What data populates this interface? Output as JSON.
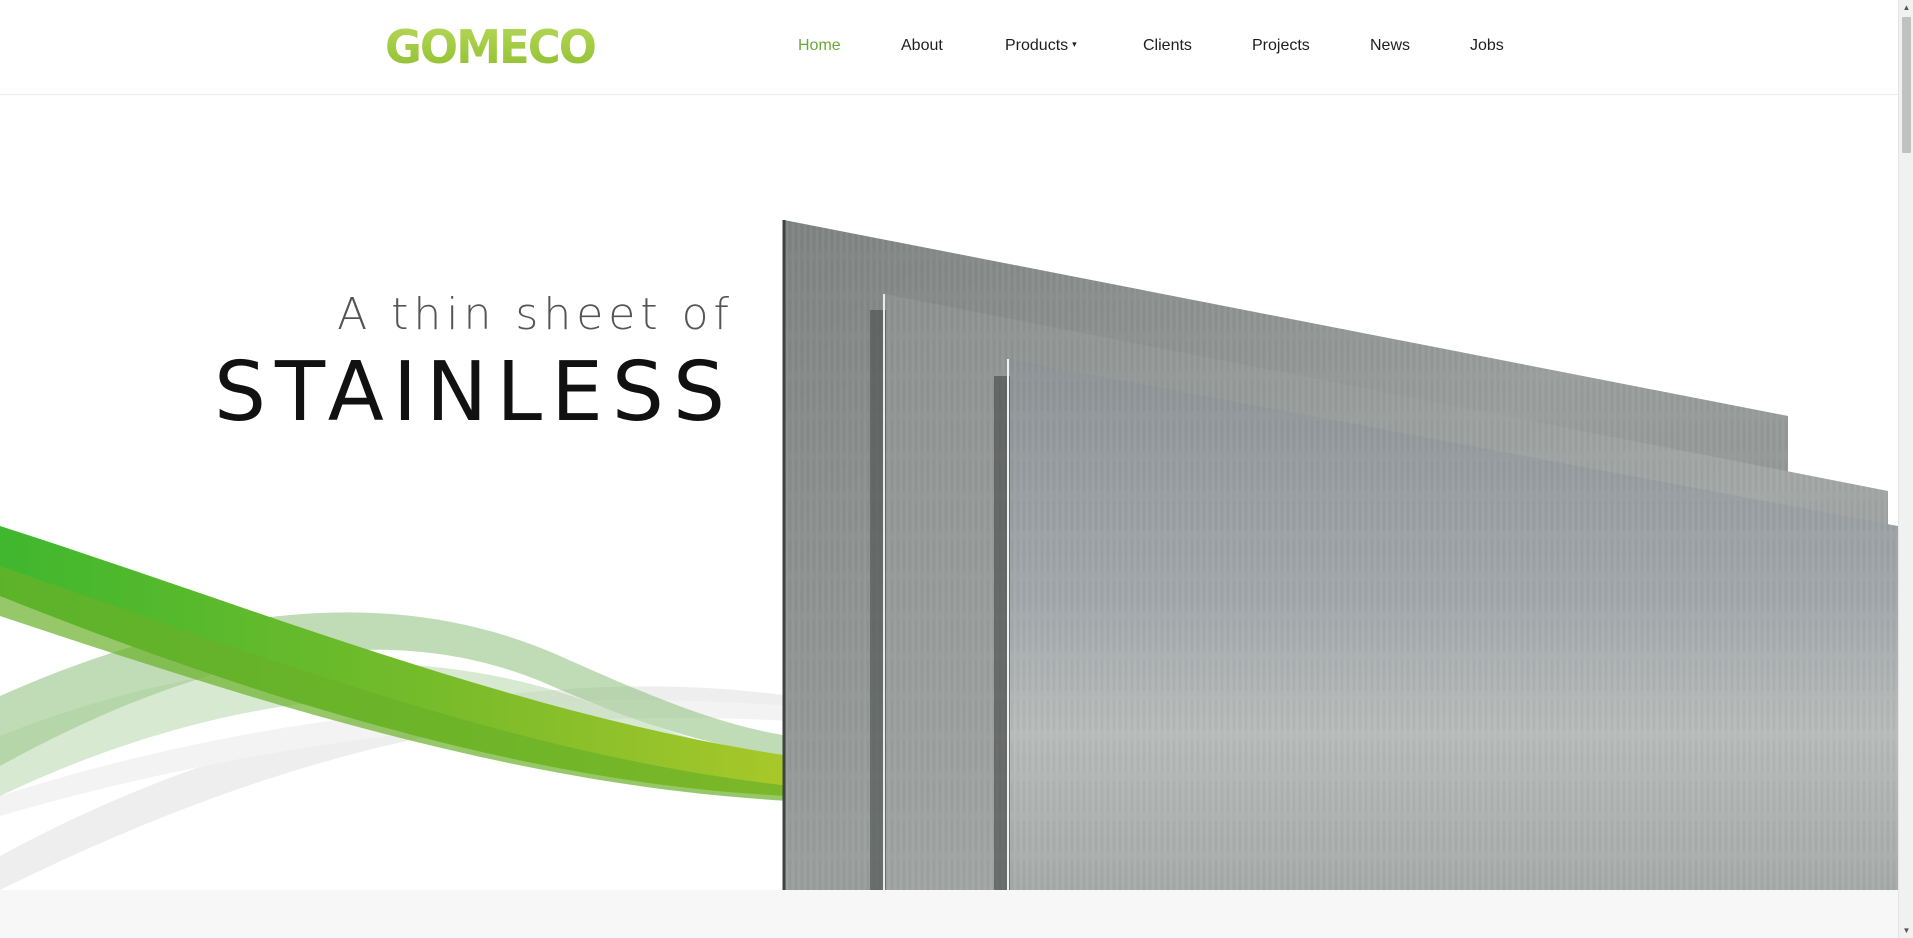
{
  "brand": {
    "logo_text": "GOMECO",
    "logo_color": "#9bc73a"
  },
  "nav": {
    "items": [
      {
        "label": "Home",
        "active": true
      },
      {
        "label": "About",
        "active": false
      },
      {
        "label": "Products",
        "active": false,
        "has_dropdown": true
      },
      {
        "label": "Clients",
        "active": false
      },
      {
        "label": "Projects",
        "active": false
      },
      {
        "label": "News",
        "active": false
      },
      {
        "label": "Jobs",
        "active": false
      }
    ],
    "caret_icon": "▾",
    "active_color": "#6aaa3a"
  },
  "hero": {
    "line1": "A thin sheet of",
    "line2": "STAINLESS",
    "image": "stainless-steel-sheets-with-green-swoosh"
  },
  "scrollbar": {
    "up_icon": "▲",
    "down_icon": "▼"
  }
}
